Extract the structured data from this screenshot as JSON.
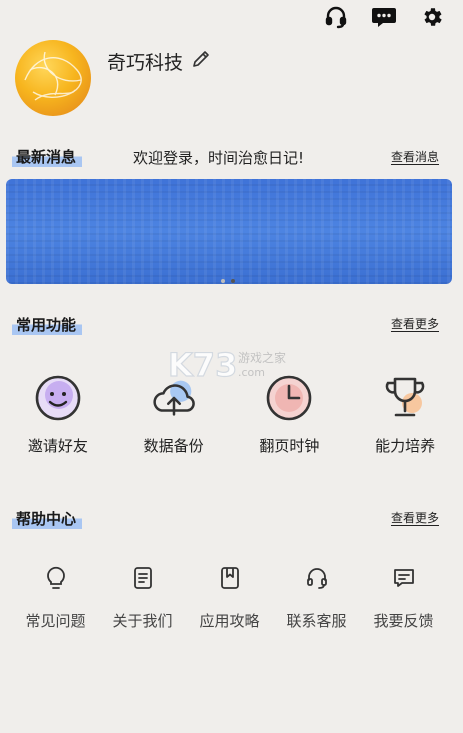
{
  "header": {
    "icons": [
      "headset-icon",
      "chat-icon",
      "gear-icon"
    ]
  },
  "profile": {
    "name": "奇巧科技",
    "edit_icon": "pencil-icon"
  },
  "news": {
    "title": "最新消息",
    "message": "欢迎登录，时间治愈日记!",
    "more": "查看消息"
  },
  "banner": {
    "page_count": 2,
    "active_index": 1
  },
  "features": {
    "title": "常用功能",
    "more": "查看更多",
    "items": [
      {
        "label": "邀请好友",
        "icon": "smile-face-icon"
      },
      {
        "label": "数据备份",
        "icon": "cloud-upload-icon"
      },
      {
        "label": "翻页时钟",
        "icon": "clock-icon"
      },
      {
        "label": "能力培养",
        "icon": "trophy-icon"
      }
    ]
  },
  "help": {
    "title": "帮助中心",
    "more": "查看更多",
    "items": [
      {
        "label": "常见问题",
        "icon": "lightbulb-icon"
      },
      {
        "label": "关于我们",
        "icon": "document-icon"
      },
      {
        "label": "应用攻略",
        "icon": "bookmark-icon"
      },
      {
        "label": "联系客服",
        "icon": "headset-icon"
      },
      {
        "label": "我要反馈",
        "icon": "feedback-icon"
      }
    ]
  },
  "watermark": {
    "logo": "K73",
    "sub": ".com",
    "text": "游戏之家"
  },
  "colors": {
    "accent_blue": "#4d84e2",
    "highlight": "#a9c6f2",
    "avatar": "#f7b51e",
    "background": "#f0eeeb"
  }
}
